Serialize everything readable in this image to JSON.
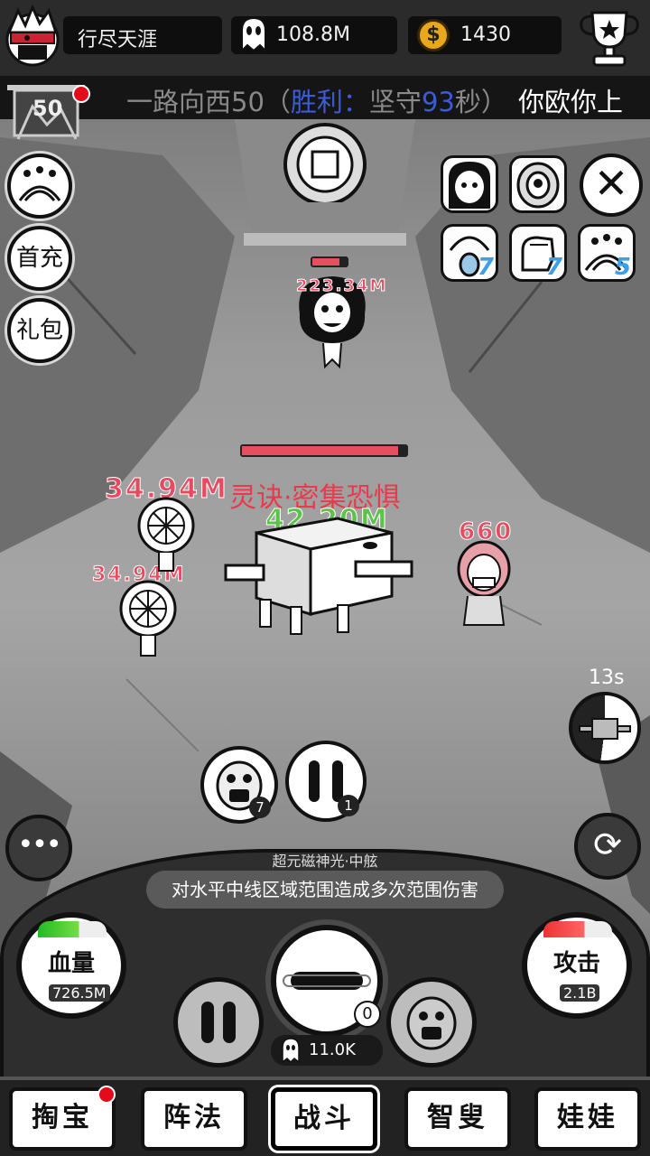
{
  "topbar": {
    "player_name": "行尽天涯",
    "ghost_currency": "108.8M",
    "coin_symbol": "$",
    "coins": "1430"
  },
  "banner": {
    "scroll_prefix": "一路向西50（",
    "scroll_win": "胜利：",
    "scroll_mid": "坚守",
    "scroll_seconds": "93",
    "scroll_suffix": "秒）",
    "right_text": "你欧你上",
    "level": "50"
  },
  "left_buttons": {
    "first_charge": "首充",
    "gift": "礼包"
  },
  "item_slots": [
    {
      "name": "peacock-item",
      "count": "7"
    },
    {
      "name": "fist-item",
      "count": "7"
    },
    {
      "name": "stand-item",
      "count": "5"
    }
  ],
  "battle": {
    "enemy_top_damage": "223.34M",
    "skill_name": "灵诀·密集恐惧",
    "damage_fan1": "34.94M",
    "damage_fan2": "34.94M",
    "damage_box": "42.20M",
    "damage_opera": "660",
    "boss_hp_fraction": 0.95,
    "enemy_top_hp_fraction": 0.8,
    "cooldown_text": "13s",
    "cooldown_fraction": 0.52
  },
  "skill_slots": [
    {
      "name": "screaming-face",
      "count": "7"
    },
    {
      "name": "pause-face",
      "count": "1"
    }
  ],
  "panel": {
    "dots": "•••",
    "refresh": "⟳",
    "skill_title": "超元磁神光·中舷",
    "skill_desc": "对水平中线区域范围造成多次范围伤害",
    "hp_label": "血量",
    "hp_value": "726.5M",
    "atk_label": "攻击",
    "atk_value": "2.1B",
    "center_count": "0",
    "ghost_total": "11.0K"
  },
  "nav": [
    {
      "label": "掏宝",
      "badge": true
    },
    {
      "label": "阵法",
      "badge": false
    },
    {
      "label": "战斗",
      "badge": false
    },
    {
      "label": "智叟",
      "badge": false
    },
    {
      "label": "娃娃",
      "badge": false
    }
  ],
  "colors": {
    "damage_red": "#e84a5f",
    "damage_green": "#5cc24a",
    "win_blue": "#3b5bd9",
    "coin_gold": "#e8a81c",
    "badge_red": "#e10b1c",
    "item_count_blue": "#3aa0e8"
  }
}
